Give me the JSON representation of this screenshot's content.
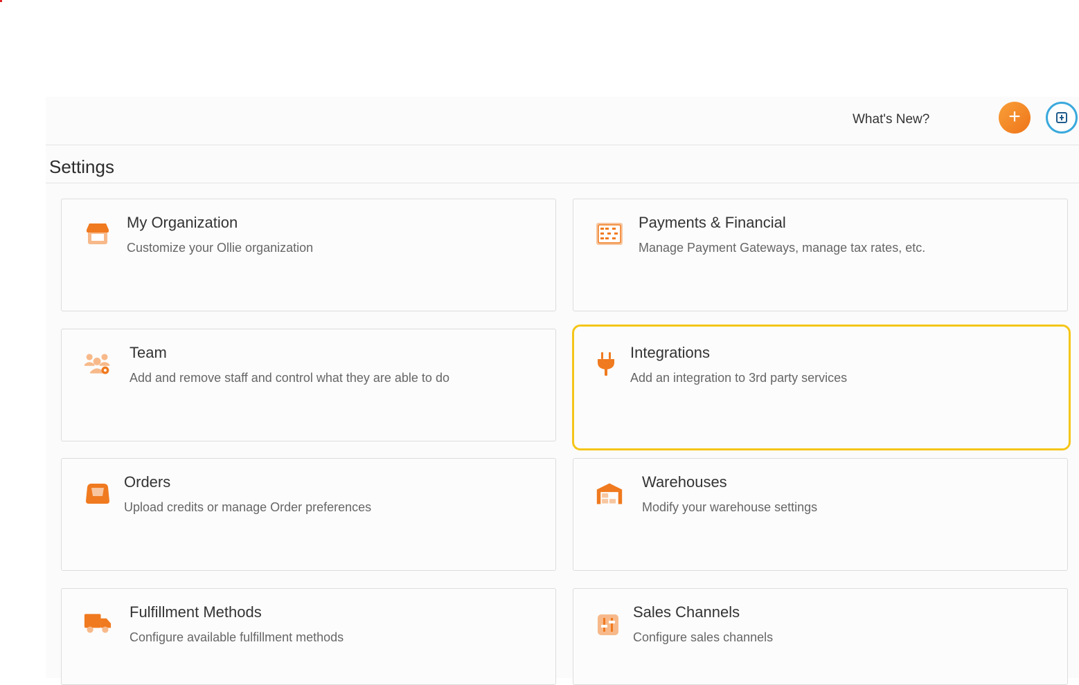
{
  "header": {
    "whats_new": "What's New?",
    "add_button_label": "+"
  },
  "page": {
    "title": "Settings"
  },
  "cards": [
    {
      "title": "My Organization",
      "description": "Customize your Ollie organization",
      "icon": "storefront-icon"
    },
    {
      "title": "Payments & Financial",
      "description": "Manage Payment Gateways, manage tax rates, etc.",
      "icon": "abacus-icon"
    },
    {
      "title": "Team",
      "description": "Add and remove staff and control what they are able to do",
      "icon": "team-settings-icon"
    },
    {
      "title": "Integrations",
      "description": "Add an integration to 3rd party services",
      "icon": "plug-icon",
      "highlighted": true
    },
    {
      "title": "Orders",
      "description": "Upload credits or manage Order preferences",
      "icon": "inbox-tray-icon"
    },
    {
      "title": "Warehouses",
      "description": "Modify your warehouse settings",
      "icon": "warehouse-icon"
    },
    {
      "title": "Fulfillment Methods",
      "description": "Configure available fulfillment methods",
      "icon": "delivery-truck-icon"
    },
    {
      "title": "Sales Channels",
      "description": "Configure sales channels",
      "icon": "channel-sliders-icon"
    }
  ],
  "colors": {
    "accent_orange": "#f08a24",
    "avatar_ring": "#3aa9dc",
    "highlight_border": "#f5c518"
  }
}
